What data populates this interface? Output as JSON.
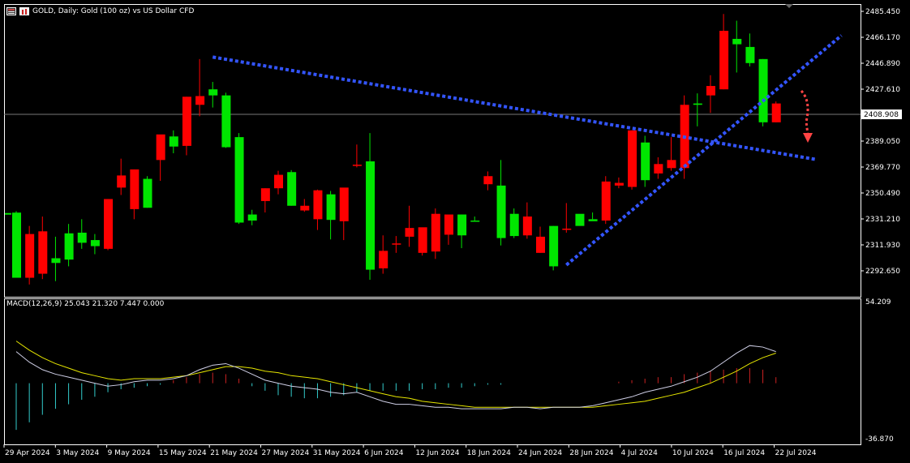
{
  "header": {
    "title": "GOLD, Daily:  Gold (100 oz) vs US Dollar CFD"
  },
  "macd_label": "MACD(12,26,9) 25.043 21.320 7.447 0.000",
  "current_price_label": "2408.908",
  "colors": {
    "background": "#000000",
    "bull": "#00e600",
    "bear": "#ff0000",
    "trendline": "#3355ff",
    "arrow": "#ff4444",
    "histogram_negative": "#33cccc",
    "histogram_positive": "#cc2222",
    "signal_line": "#e6e600",
    "macd_line": "#cfcfe6",
    "axis": "#ffffff",
    "price_line": "#777777"
  },
  "chart_data": {
    "type": "candlestick",
    "price_axis_ticks": [
      "2485.450",
      "2466.170",
      "2446.890",
      "2427.610",
      "2389.050",
      "2369.770",
      "2350.490",
      "2331.210",
      "2311.930",
      "2292.650"
    ],
    "macd_axis_ticks": [
      "54.209",
      "-36.870"
    ],
    "date_ticks": [
      "29 Apr 2024",
      "3 May 2024",
      "9 May 2024",
      "15 May 2024",
      "21 May 2024",
      "27 May 2024",
      "31 May 2024",
      "6 Jun 2024",
      "12 Jun 2024",
      "18 Jun 2024",
      "24 Jun 2024",
      "28 Jun 2024",
      "4 Jul 2024",
      "10 Jul 2024",
      "16 Jul 2024",
      "22 Jul 2024"
    ],
    "current_price": 2408.908,
    "candles": [
      [
        2335.9,
        2337.0,
        2289.1,
        2287.5
      ],
      [
        2287.5,
        2326.0,
        2282.5,
        2320.0
      ],
      [
        2322.0,
        2333.0,
        2286.5,
        2290.5
      ],
      [
        2298.5,
        2318.0,
        2285.0,
        2302.0
      ],
      [
        2301.0,
        2327.5,
        2296.0,
        2320.5
      ],
      [
        2321.0,
        2331.0,
        2309.0,
        2313.5
      ],
      [
        2315.5,
        2320.0,
        2305.0,
        2311.0
      ],
      [
        2309.0,
        2346.0,
        2308.0,
        2346.0
      ],
      [
        2354.5,
        2376.0,
        2349.0,
        2363.5
      ],
      [
        2338.5,
        2368.0,
        2331.0,
        2368.0
      ],
      [
        2361.0,
        2363.0,
        2339.5,
        2339.5
      ],
      [
        2375.0,
        2393.0,
        2359.5,
        2394.0
      ],
      [
        2392.5,
        2397.0,
        2380.0,
        2385.0
      ],
      [
        2385.5,
        2422.0,
        2378.5,
        2422.0
      ],
      [
        2416.0,
        2450.0,
        2407.5,
        2422.5
      ],
      [
        2427.5,
        2433.0,
        2414.0,
        2423.0
      ],
      [
        2423.0,
        2425.0,
        2384.0,
        2384.5
      ],
      [
        2392.0,
        2395.0,
        2327.5,
        2328.5
      ],
      [
        2330.0,
        2338.0,
        2326.5,
        2334.5
      ],
      [
        2344.5,
        2354.0,
        2336.0,
        2354.0
      ],
      [
        2364.0,
        2367.0,
        2349.5,
        2354.0
      ],
      [
        2366.0,
        2367.5,
        2341.0,
        2341.0
      ],
      [
        2341.0,
        2346.0,
        2336.5,
        2337.5
      ],
      [
        2331.0,
        2353.0,
        2323.0,
        2352.5
      ],
      [
        2349.5,
        2352.0,
        2316.0,
        2330.5
      ],
      [
        2329.5,
        2354.0,
        2315.5,
        2354.5
      ],
      [
        2371.5,
        2386.5,
        2369.5,
        2371.5
      ],
      [
        2374.0,
        2395.0,
        2286.0,
        2293.5
      ],
      [
        2307.5,
        2319.0,
        2290.5,
        2294.5
      ],
      [
        2313.0,
        2318.5,
        2306.0,
        2313.0
      ],
      [
        2318.0,
        2341.0,
        2310.5,
        2324.5
      ],
      [
        2325.0,
        2324.5,
        2304.0,
        2306.0
      ],
      [
        2335.0,
        2339.0,
        2301.5,
        2307.0
      ],
      [
        2319.5,
        2333.0,
        2312.0,
        2334.5
      ],
      [
        2334.5,
        2334.5,
        2309.5,
        2319.0
      ],
      [
        2329.5,
        2333.0,
        2329.5,
        2330.0
      ],
      [
        2363.0,
        2366.5,
        2352.5,
        2357.0
      ],
      [
        2356.0,
        2375.0,
        2311.5,
        2317.0
      ],
      [
        2335.0,
        2339.0,
        2317.0,
        2318.5
      ],
      [
        2319.0,
        2343.5,
        2316.5,
        2333.0
      ],
      [
        2318.0,
        2325.5,
        2306.0,
        2306.0
      ],
      [
        2296.0,
        2326.0,
        2293.0,
        2326.0
      ],
      [
        2324.0,
        2343.0,
        2321.0,
        2324.0
      ],
      [
        2326.0,
        2332.0,
        2330.5,
        2335.0
      ],
      [
        2329.5,
        2336.0,
        2331.0,
        2331.0
      ],
      [
        2330.0,
        2363.0,
        2327.5,
        2359.0
      ],
      [
        2358.0,
        2362.0,
        2354.0,
        2356.0
      ],
      [
        2355.0,
        2397.0,
        2353.0,
        2397.0
      ],
      [
        2360.0,
        2393.0,
        2355.0,
        2388.0
      ],
      [
        2365.0,
        2377.0,
        2361.0,
        2372.0
      ],
      [
        2369.0,
        2392.0,
        2367.0,
        2375.0
      ],
      [
        2416.0,
        2423.0,
        2361.0,
        2369.0
      ],
      [
        2417.0,
        2424.5,
        2400.0,
        2416.0
      ],
      [
        2430.0,
        2438.0,
        2410.0,
        2423.0
      ],
      [
        2471.0,
        2483.5,
        2427.5,
        2427.5
      ],
      [
        2465.0,
        2478.5,
        2440.0,
        2461.0
      ],
      [
        2459.0,
        2469.0,
        2444.5,
        2447.0
      ],
      [
        2450.0,
        2450.0,
        2400.0,
        2403.0
      ],
      [
        2417.0,
        2418.5,
        2403.0,
        2403.0
      ]
    ],
    "candle_colors": [
      "bull",
      "bear",
      "bear",
      "bull",
      "bull",
      "bull",
      "bull",
      "bear",
      "bear",
      "bear",
      "bull",
      "bear",
      "bull",
      "bear",
      "bear",
      "bull",
      "bull",
      "bull",
      "bull",
      "bear",
      "bear",
      "bull",
      "bear",
      "bear",
      "bull",
      "bear",
      "bear",
      "bull",
      "bear",
      "bear",
      "bear",
      "bear",
      "bear",
      "bear",
      "bull",
      "bull",
      "bear",
      "bull",
      "bull",
      "bear",
      "bear",
      "bull",
      "bear",
      "bull",
      "bull",
      "bear",
      "bear",
      "bear",
      "bull",
      "bear",
      "bear",
      "bear",
      "bull",
      "bear",
      "bear",
      "bull",
      "bull",
      "bull",
      "bear"
    ],
    "macd_histogram": [
      -31,
      -26,
      -21,
      -17,
      -14,
      -11,
      -9,
      -6,
      -4,
      -3,
      -2,
      -1,
      2,
      4,
      6,
      7,
      6,
      3,
      -2,
      -5,
      -8,
      -9,
      -10,
      -10,
      -9,
      -8,
      -6,
      -5,
      -5,
      -5,
      -5,
      -4,
      -4,
      -3,
      -3,
      -2,
      -1,
      -1,
      0,
      0,
      0,
      0,
      0,
      0,
      0,
      0,
      1,
      2,
      3,
      4,
      4,
      6,
      7,
      8,
      9,
      10,
      10,
      9,
      4
    ],
    "macd_line": [
      21,
      14,
      9,
      6,
      4,
      2,
      0,
      -2,
      -1,
      1,
      2,
      2,
      3,
      5,
      9,
      12,
      13,
      10,
      6,
      2,
      0,
      -2,
      -3,
      -4,
      -6,
      -7,
      -6,
      -9,
      -12,
      -14,
      -14,
      -15,
      -16,
      -16,
      -17,
      -17,
      -17,
      -17,
      -16,
      -16,
      -17,
      -16,
      -16,
      -16,
      -15,
      -13,
      -11,
      -9,
      -6,
      -4,
      -2,
      1,
      4,
      8,
      14,
      20,
      25,
      24,
      21
    ],
    "signal_line": [
      28,
      22,
      17,
      13,
      10,
      7,
      5,
      3,
      2,
      3,
      3,
      3,
      4,
      5,
      7,
      9,
      11,
      11,
      10,
      8,
      7,
      5,
      4,
      3,
      1,
      -1,
      -3,
      -5,
      -7,
      -9,
      -10,
      -12,
      -13,
      -14,
      -15,
      -16,
      -16,
      -16,
      -16,
      -16,
      -16,
      -16,
      -16,
      -16,
      -16,
      -15,
      -14,
      -13,
      -12,
      -10,
      -8,
      -6,
      -3,
      0,
      4,
      8,
      13,
      17,
      20
    ],
    "lines": [
      {
        "name": "resistance",
        "points": [
          [
            "2024-05-20",
            2451.5
          ],
          [
            "2024-07-23",
            2375.5
          ]
        ]
      },
      {
        "name": "support",
        "points": [
          [
            "2024-06-26",
            2297.0
          ],
          [
            "2024-07-25",
            2467.5
          ]
        ]
      }
    ]
  }
}
